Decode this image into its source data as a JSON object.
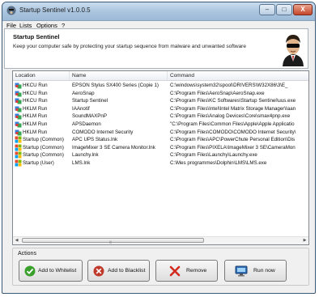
{
  "window": {
    "title": "Startup Sentinel v1.0.0.5",
    "controls": {
      "minimize": "–",
      "maximize": "□",
      "close": "X"
    }
  },
  "menu": [
    "File",
    "Lists",
    "Options",
    "?"
  ],
  "header": {
    "title": "Startup Sentinel",
    "subtitle": "Keep your computer safe by protecting your startup sequence from malware and unwanted software"
  },
  "list": {
    "columns": [
      "Location",
      "Name",
      "Command"
    ],
    "rows": [
      {
        "icon": "registry-icon",
        "location": "HKCU Run",
        "name": "EPSON Stylus SX400 Series (Copie 1)",
        "command": "C:\\windows\\system32\\spool\\DRIVERS\\W32X86\\3\\E_"
      },
      {
        "icon": "registry-icon",
        "location": "HKCU Run",
        "name": "AeroSnap",
        "command": "C:\\Program Files\\AeroSnap\\AeroSnap.exe"
      },
      {
        "icon": "registry-icon",
        "location": "HKCU Run",
        "name": "Startup Sentinel",
        "command": "C:\\Program Files\\KC Softwares\\Startup Sentinel\\uus.exe"
      },
      {
        "icon": "registry-icon",
        "location": "HKLM Run",
        "name": "IAAnotif",
        "command": "C:\\Program Files\\Intel\\Intel Matrix Storage Manager\\Iaan"
      },
      {
        "icon": "registry-icon",
        "location": "HKLM Run",
        "name": "SoundMAXPnP",
        "command": "C:\\Program Files\\Analog Devices\\Core\\smax4pnp.exe"
      },
      {
        "icon": "registry-icon",
        "location": "HKLM Run",
        "name": "APSDaemon",
        "command": "\"C:\\Program Files\\Common Files\\Apple\\Apple Applicatio"
      },
      {
        "icon": "registry-icon",
        "location": "HKLM Run",
        "name": "COMODO Internet Security",
        "command": "C:\\Program Files\\COMODO\\COMODO Internet Security\\"
      },
      {
        "icon": "windows-icon",
        "location": "Startup (Common)",
        "name": "APC UPS Status.lnk",
        "command": "C:\\Program Files\\APC\\PowerChute Personal Edition\\Dis"
      },
      {
        "icon": "windows-icon",
        "location": "Startup (Common)",
        "name": "ImageMixer 3 SE Camera Monitor.lnk",
        "command": "C:\\Program Files\\PIXELA\\ImageMixer 3 SE\\CameraMon"
      },
      {
        "icon": "windows-icon",
        "location": "Startup (Common)",
        "name": "Launchy.lnk",
        "command": "C:\\Program Files\\Launchy\\Launchy.exe"
      },
      {
        "icon": "windows-icon",
        "location": "Startup (User)",
        "name": "LMS.lnk",
        "command": "C:\\Mes programmes\\Dolphin\\LMS\\LMS.exe"
      }
    ]
  },
  "actions": {
    "label": "Actions",
    "buttons": [
      {
        "label": "Add to Whitelist",
        "icon": "check-circle-icon",
        "color": "#3aa02c"
      },
      {
        "label": "Add to Blacklist",
        "icon": "stop-circle-icon",
        "color": "#c0392b"
      },
      {
        "label": "Remove",
        "icon": "red-x-icon",
        "color": "#d22a1e"
      },
      {
        "label": "Run now",
        "icon": "monitor-icon",
        "color": "#2f6fb8"
      }
    ]
  }
}
